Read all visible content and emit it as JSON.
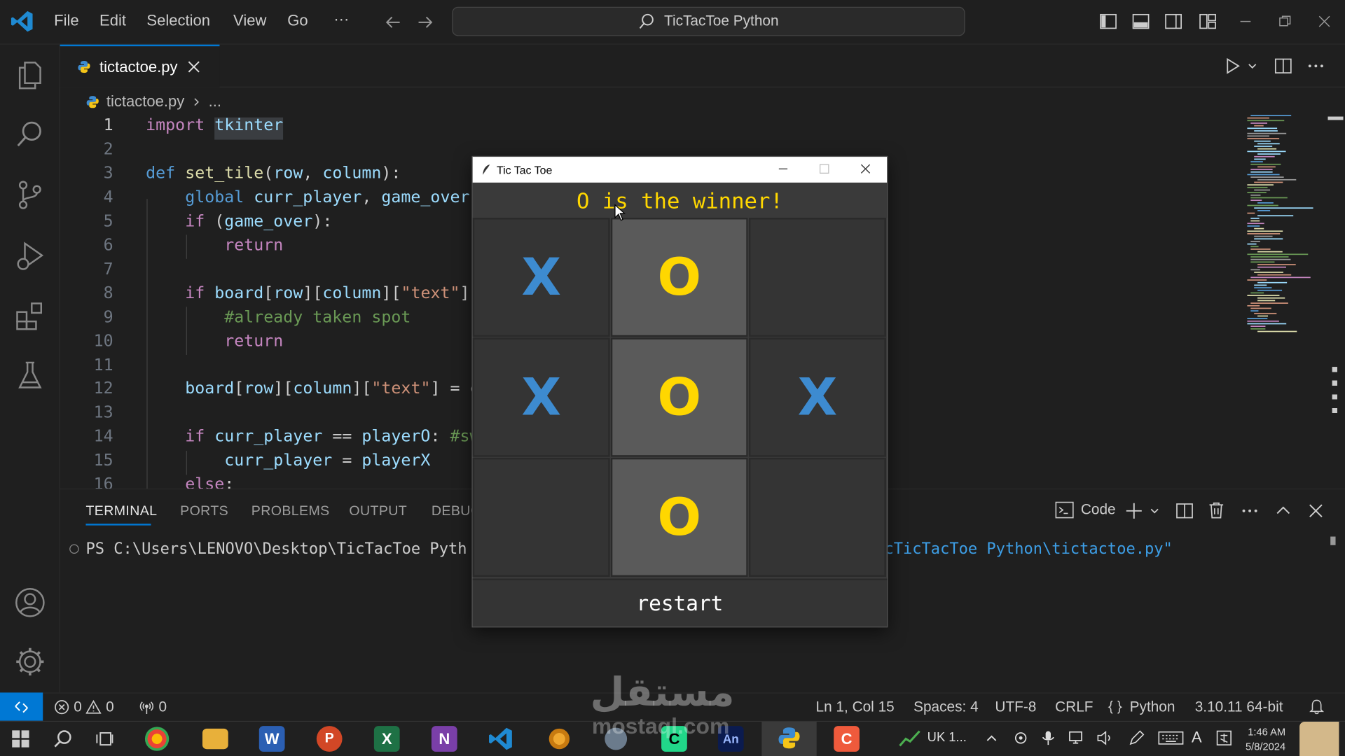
{
  "colors": {
    "accent": "#0078d4",
    "x_mark": "#3d8bd0",
    "o_mark": "#ffd700"
  },
  "menu": {
    "file": "File",
    "edit": "Edit",
    "selection": "Selection",
    "view": "View",
    "go": "Go",
    "more": "···"
  },
  "command_center": {
    "text": "TicTacToe Python"
  },
  "tab": {
    "label": "tictactoe.py"
  },
  "breadcrumb": {
    "file": "tictactoe.py",
    "rest": "..."
  },
  "code_lines": [
    {
      "n": "1",
      "text": "import tkinter"
    },
    {
      "n": "2",
      "text": ""
    },
    {
      "n": "3",
      "text": "def set_tile(row, column):"
    },
    {
      "n": "4",
      "text": "    global curr_player, game_over"
    },
    {
      "n": "5",
      "text": "    if (game_over):"
    },
    {
      "n": "6",
      "text": "        return"
    },
    {
      "n": "7",
      "text": ""
    },
    {
      "n": "8",
      "text": "    if board[row][column][\"text\"]"
    },
    {
      "n": "9",
      "text": "        #already taken spot"
    },
    {
      "n": "10",
      "text": "        return"
    },
    {
      "n": "11",
      "text": ""
    },
    {
      "n": "12",
      "text": "    board[row][column][\"text\"] = c"
    },
    {
      "n": "13",
      "text": ""
    },
    {
      "n": "14",
      "text": "    if curr_player == playerO: #sw"
    },
    {
      "n": "15",
      "text": "        curr_player = playerX"
    },
    {
      "n": "16",
      "text": "    else:"
    }
  ],
  "panel": {
    "tabs": [
      "TERMINAL",
      "PORTS",
      "PROBLEMS",
      "OUTPUT",
      "DEBUG"
    ],
    "terminal_name": "Code",
    "prompt": "PS C:\\Users\\LENOVO\\Desktop\\TicTacToe Pyth",
    "command_tail": "cTicTacToe Python\\tictactoe.py\""
  },
  "status": {
    "errors": "0",
    "warnings": "0",
    "ports": "0",
    "position": "Ln 1, Col 15",
    "spaces": "Spaces: 4",
    "encoding": "UTF-8",
    "eol": "CRLF",
    "language": "Python",
    "interpreter": "3.10.11 64-bit"
  },
  "tkwindow": {
    "title": "Tic Tac Toe",
    "status": "O is the winner!",
    "board": [
      [
        "X",
        "O",
        ""
      ],
      [
        "X",
        "O",
        "X"
      ],
      [
        "",
        "O",
        ""
      ]
    ],
    "restart_label": "restart"
  },
  "taskbar": {
    "tray_item": "UK 1...",
    "time": "1:46 AM",
    "date": "5/8/2024"
  },
  "watermark": {
    "arabic": "مستقل",
    "latin": "mostaql.com"
  }
}
